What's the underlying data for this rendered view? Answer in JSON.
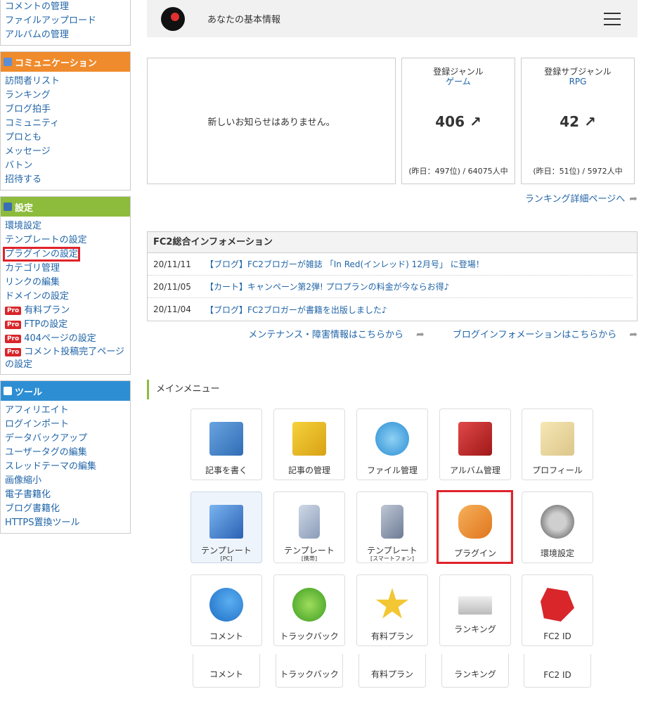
{
  "sidebar": {
    "top_items": [
      "コメントの管理",
      "ファイルアップロード",
      "アルバムの管理"
    ],
    "communication": {
      "title": "コミュニケーション",
      "items": [
        "訪問者リスト",
        "ランキング",
        "ブログ拍手",
        "コミュニティ",
        "プロとも",
        "メッセージ",
        "バトン",
        "招待する"
      ]
    },
    "settings": {
      "title": "設定",
      "items": [
        "環境設定",
        "テンプレートの設定",
        "プラグインの設定",
        "カテゴリ管理",
        "リンクの編集",
        "ドメインの設定"
      ],
      "pro_badge": "Pro",
      "pro_items": [
        "有料プラン",
        "FTPの設定",
        "404ページの設定",
        "コメント投稿完了ページの設定"
      ]
    },
    "tools": {
      "title": "ツール",
      "items": [
        "アフィリエイト",
        "ログインポート",
        "データバックアップ",
        "ユーザータグの編集",
        "スレッドテーマの編集",
        "画像縮小",
        "電子書籍化",
        "ブログ書籍化",
        "HTTPS置換ツール"
      ]
    },
    "colors": {
      "communication": "#ef8b2c",
      "settings": "#8dbb3c",
      "tools": "#2d8ed3",
      "highlight": "#e0232b"
    }
  },
  "header": {
    "title": "あなたの基本情報",
    "menu_icon": "hamburger-icon"
  },
  "notice": {
    "text": "新しいお知らせはありません。"
  },
  "stats": [
    {
      "label": "登録ジャンル",
      "genre": "ゲーム",
      "rank": "406 ↗",
      "detail": "(昨日：497位) / 64075人中"
    },
    {
      "label": "登録サブジャンル",
      "genre": "RPG",
      "rank": "42 ↗",
      "detail": "(昨日：51位) / 5972人中"
    }
  ],
  "ranking_link": "ランキング詳細ページへ",
  "info": {
    "title": "FC2総合インフォメーション",
    "rows": [
      {
        "date": "20/11/11",
        "text": "【ブログ】FC2ブロガーが雑誌 「In Red(インレッド) 12月号」 に登場！"
      },
      {
        "date": "20/11/05",
        "text": "【カート】キャンペーン第2弾! プロプランの料金が今ならお得♪"
      },
      {
        "date": "20/11/04",
        "text": "【ブログ】FC2ブロガーが書籍を出版しました♪"
      }
    ]
  },
  "links": {
    "maintenance": "メンテナンス・障害情報はこちらから",
    "blog_info": "ブログインフォメーションはこちらから"
  },
  "main_menu": {
    "title": "メインメニュー",
    "tiles": [
      {
        "label": "記事を書く",
        "icon": "write-icon"
      },
      {
        "label": "記事の管理",
        "icon": "edit-folder-icon"
      },
      {
        "label": "ファイル管理",
        "icon": "disk-icon"
      },
      {
        "label": "アルバム管理",
        "icon": "album-icon"
      },
      {
        "label": "プロフィール",
        "icon": "profile-card-icon"
      },
      {
        "label": "テンプレート",
        "sub": "[PC]",
        "icon": "pc-template-icon"
      },
      {
        "label": "テンプレート",
        "sub": "[携帯]",
        "icon": "mobile-template-icon"
      },
      {
        "label": "テンプレート",
        "sub": "[スマートフォン]",
        "icon": "smartphone-template-icon"
      },
      {
        "label": "プラグイン",
        "icon": "plugin-icon"
      },
      {
        "label": "環境設定",
        "icon": "gears-icon"
      },
      {
        "label": "コメント",
        "icon": "comment-icon"
      },
      {
        "label": "トラックバック",
        "icon": "trackback-icon"
      },
      {
        "label": "有料プラン",
        "icon": "star-icon"
      },
      {
        "label": "ランキング",
        "icon": "podium-icon"
      },
      {
        "label": "FC2 ID",
        "icon": "fc2-id-icon"
      }
    ],
    "repeat_row": [
      "コメント",
      "トラックバック",
      "有料プラン",
      "ランキング",
      "FC2 ID"
    ]
  }
}
